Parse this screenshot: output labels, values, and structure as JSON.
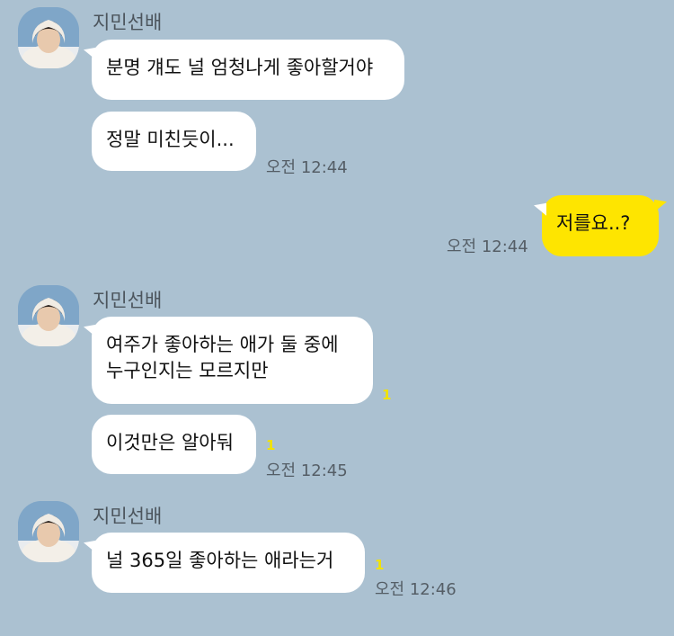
{
  "colors": {
    "background": "#abc1d1",
    "incoming_bubble": "#ffffff",
    "outgoing_bubble": "#fee500",
    "unread_count": "#f2e300"
  },
  "messages": [
    {
      "sender": "지민선배",
      "avatar": "profile-photo",
      "bubbles": [
        {
          "text": "분명 걔도 널 엄청나게 좋아할거야"
        },
        {
          "text": "정말 미친듯이..."
        }
      ],
      "time": "오전 12:44"
    },
    {
      "direction": "outgoing",
      "bubbles": [
        {
          "text": "저를요..?"
        }
      ],
      "time": "오전 12:44"
    },
    {
      "sender": "지민선배",
      "avatar": "profile-photo",
      "bubbles": [
        {
          "line1": "여주가 좋아하는 애가 둘 중에",
          "line2": "누구인지는 모르지만",
          "unread": "1"
        },
        {
          "text": "이것만은 알아둬",
          "unread": "1"
        }
      ],
      "time": "오전 12:45"
    },
    {
      "sender": "지민선배",
      "avatar": "profile-photo",
      "bubbles": [
        {
          "text": "널 365일 좋아하는 애라는거",
          "unread": "1"
        }
      ],
      "time": "오전 12:46"
    }
  ]
}
